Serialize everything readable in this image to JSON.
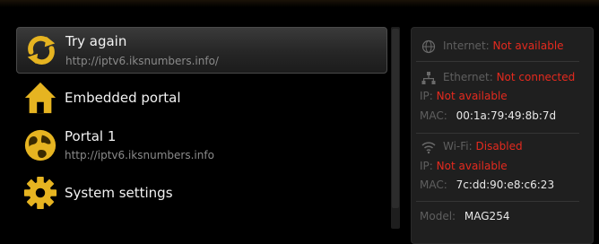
{
  "menu": {
    "items": [
      {
        "title": "Try again",
        "subtitle": "http://iptv6.iksnumbers.info/",
        "icon": "refresh-icon",
        "selected": true
      },
      {
        "title": "Embedded portal",
        "icon": "home-icon"
      },
      {
        "title": "Portal 1",
        "subtitle": "http://iptv6.iksnumbers.info",
        "icon": "globe-icon"
      },
      {
        "title": "System settings",
        "icon": "gear-icon"
      }
    ]
  },
  "status": {
    "internet": {
      "label": "Internet:",
      "value": "Not available",
      "icon": "globe-icon"
    },
    "ethernet": {
      "label": "Ethernet:",
      "value": "Not connected",
      "icon": "network-icon",
      "ip_label": "IP:",
      "ip_value": "Not available",
      "mac_label": "MAC:",
      "mac_value": "00:1a:79:49:8b:7d"
    },
    "wifi": {
      "label": "Wi-Fi:",
      "value": "Disabled",
      "icon": "wifi-icon",
      "ip_label": "IP:",
      "ip_value": "Not available",
      "mac_label": "MAC:",
      "mac_value": "7c:dd:90:e8:c6:23"
    },
    "model": {
      "label": "Model:",
      "value": "MAG254"
    }
  },
  "colors": {
    "accent_gold": "#e6b421",
    "error_red": "#e52a1f",
    "selected_bg": "#2e2e2e"
  }
}
